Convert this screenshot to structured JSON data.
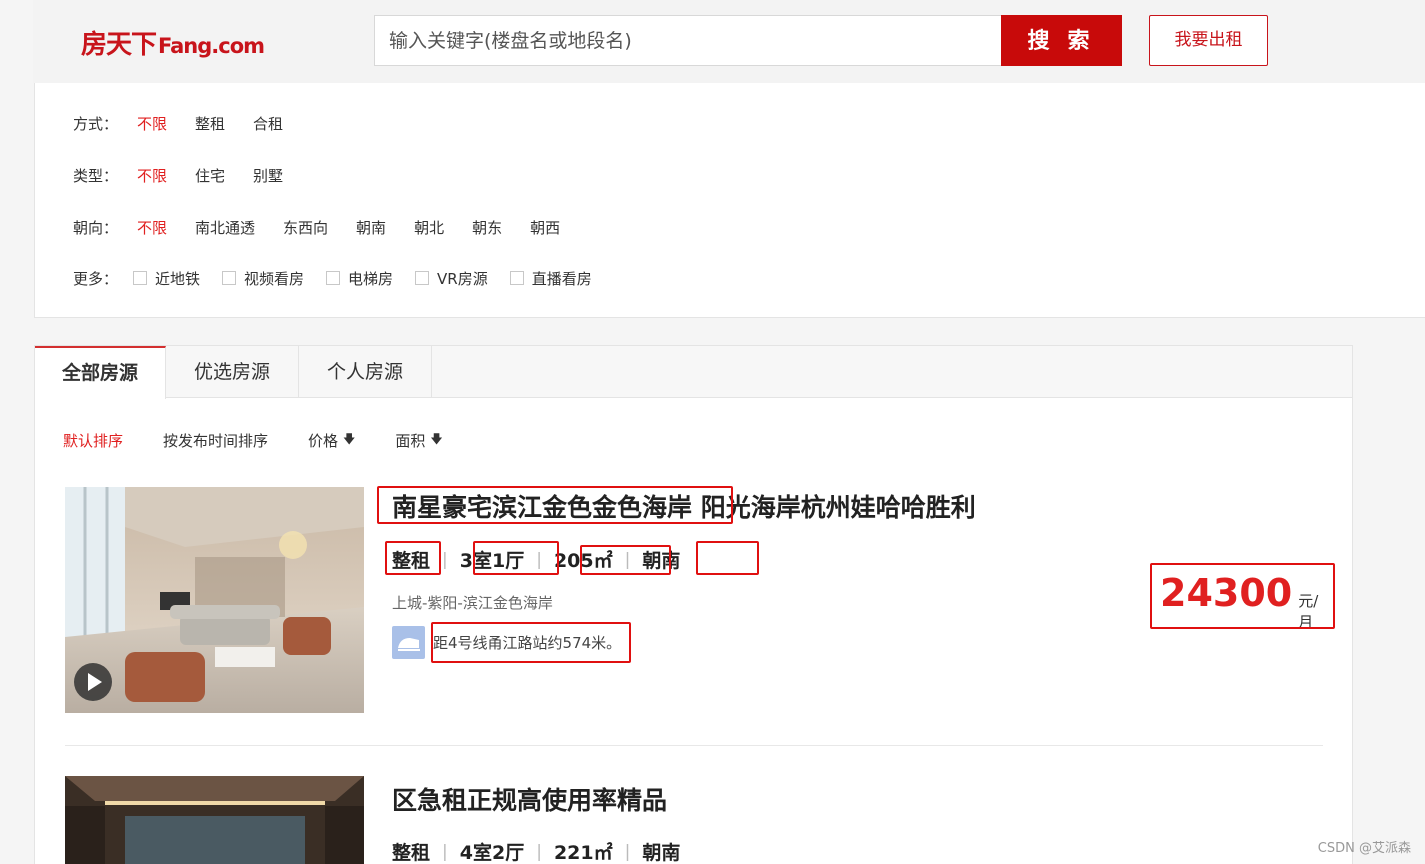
{
  "header": {
    "logo_cn": "房天下",
    "logo_en": "Fang.com",
    "search_placeholder": "输入关键字(楼盘名或地段名)",
    "search_label": "搜 索",
    "rent_label": "我要出租"
  },
  "filters": {
    "mode": {
      "label": "方式：",
      "options": [
        "不限",
        "整租",
        "合租"
      ]
    },
    "type": {
      "label": "类型：",
      "options": [
        "不限",
        "住宅",
        "别墅"
      ]
    },
    "orient": {
      "label": "朝向：",
      "options": [
        "不限",
        "南北通透",
        "东西向",
        "朝南",
        "朝北",
        "朝东",
        "朝西"
      ]
    },
    "more": {
      "label": "更多：",
      "options": [
        "近地铁",
        "视频看房",
        "电梯房",
        "VR房源",
        "直播看房"
      ]
    }
  },
  "tabs": [
    "全部房源",
    "优选房源",
    "个人房源"
  ],
  "sorts": [
    "默认排序",
    "按发布时间排序",
    "价格",
    "面积"
  ],
  "listings": [
    {
      "title": "南星豪宅滨江金色金色海岸 阳光海岸杭州娃哈哈胜利",
      "rent_type": "整租",
      "layout": "3室1厅",
      "area": "205㎡",
      "orientation": "朝南",
      "location": "上城-紫阳-滨江金色海岸",
      "metro": "距4号线甬江路站约574米。",
      "price": "24300",
      "price_unit": "元/月"
    },
    {
      "title": "区急租正规高使用率精品",
      "rent_type": "整租",
      "layout": "4室2厅",
      "area": "221㎡",
      "orientation": "朝南"
    }
  ],
  "watermark": "CSDN @艾派森",
  "colors": {
    "brand_red": "#c8141b",
    "active_red": "#e02020",
    "button_red": "#c80a0a"
  }
}
